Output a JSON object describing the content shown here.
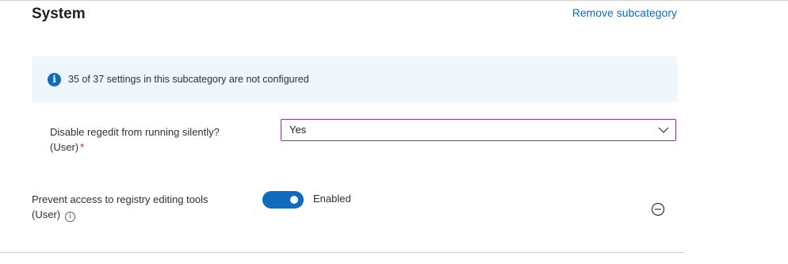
{
  "section": {
    "title": "System",
    "remove_link": "Remove subcategory"
  },
  "info_banner": {
    "icon": "info-icon",
    "text": "35 of 37 settings in this subcategory are not configured"
  },
  "settings": [
    {
      "label_line1": "Disable regedit from running silently?",
      "label_line2": "(User)",
      "required_marker": "*",
      "control": "dropdown",
      "value": "Yes",
      "icon": "chevron-down-icon"
    },
    {
      "label_line1": "Prevent access to registry editing tools",
      "label_line2": "(User)",
      "help_icon": "info-circle-icon",
      "control": "toggle",
      "toggle_on": true,
      "toggle_label": "Enabled",
      "remove_icon": "minus-circle-icon"
    }
  ],
  "colors": {
    "accent": "#0f6cbd",
    "banner_bg": "#eff6fc",
    "dropdown_border": "#8a3ba0",
    "required": "#a4262c"
  }
}
